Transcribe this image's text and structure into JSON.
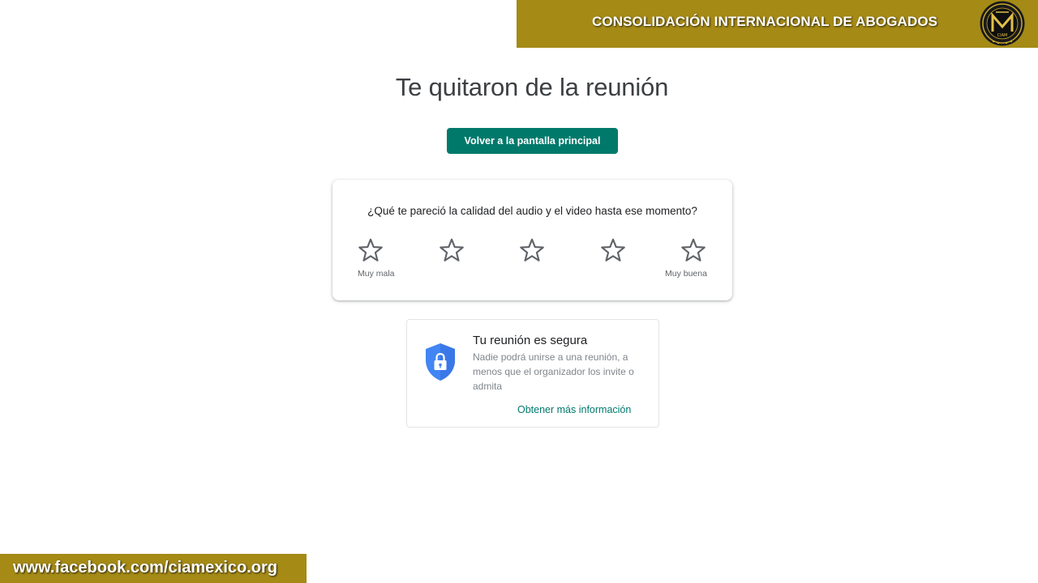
{
  "banner": {
    "title": "CONSOLIDACIÓN INTERNACIONAL DE ABOGADOS",
    "logo_text": "CIAM",
    "color": "#a58a16"
  },
  "footer_banner": {
    "url": "www.facebook.com/ciamexico.org"
  },
  "main": {
    "title": "Te quitaron de la reunión",
    "home_button_label": "Volver a la pantalla principal",
    "accent_color": "#00796b"
  },
  "rating": {
    "question": "¿Qué te pareció la calidad del audio y el video hasta ese momento?",
    "stars": [
      {
        "icon": "star-outline-icon"
      },
      {
        "icon": "star-outline-icon"
      },
      {
        "icon": "star-outline-icon"
      },
      {
        "icon": "star-outline-icon"
      },
      {
        "icon": "star-outline-icon"
      }
    ],
    "low_label": "Muy mala",
    "high_label": "Muy buena"
  },
  "security": {
    "icon": "shield-lock-icon",
    "title": "Tu reunión es segura",
    "body": "Nadie podrá unirse a una reunión, a menos que el organizador los invite o admita",
    "link_label": "Obtener más información"
  }
}
